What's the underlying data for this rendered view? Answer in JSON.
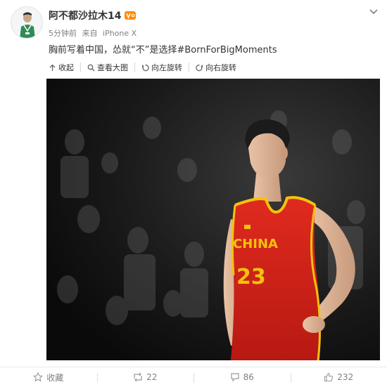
{
  "user": {
    "name": "阿不都沙拉木14",
    "avatar_label": "avatar",
    "vip_badge": "vip-icon"
  },
  "meta": {
    "time": "5分钟前",
    "source_prefix": "来自",
    "source_device": "iPhone X"
  },
  "post": {
    "text": "胸前写着中国，怂就“不”是选择#BornForBigMoments"
  },
  "toolbar": {
    "collapse": "收起",
    "view_large": "查看大图",
    "rotate_left": "向左旋转",
    "rotate_right": "向右旋转"
  },
  "photo": {
    "jersey_text": "CHINA",
    "jersey_number": "23"
  },
  "footer": {
    "favorite": "收藏",
    "reposts": "22",
    "comments": "86",
    "likes": "232"
  },
  "colors": {
    "text": "#333333",
    "muted": "#808080",
    "jersey_red": "#d3241c",
    "jersey_yellow": "#f4c20d"
  }
}
